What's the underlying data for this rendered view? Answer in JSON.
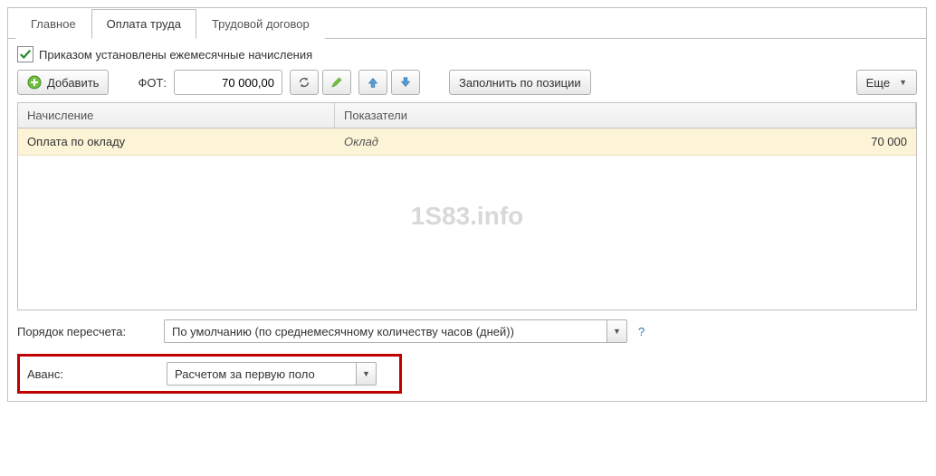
{
  "tabs": {
    "main": "Главное",
    "pay": "Оплата труда",
    "contract": "Трудовой договор"
  },
  "checkbox_label": "Приказом установлены ежемесячные начисления",
  "toolbar": {
    "add": "Добавить",
    "fot_label": "ФОТ:",
    "fot_value": "70 000,00",
    "fill_by_position": "Заполнить по позиции",
    "more": "Еще"
  },
  "table": {
    "headers": {
      "accrual": "Начисление",
      "indicators": "Показатели"
    },
    "rows": [
      {
        "name": "Оплата по окладу",
        "indicator": "Оклад",
        "value": "70 000"
      }
    ]
  },
  "watermark": "1S83.info",
  "recalc": {
    "label": "Порядок пересчета:",
    "value": "По умолчанию (по среднемесячному количеству часов (дней))",
    "help": "?"
  },
  "advance": {
    "label": "Аванс:",
    "value": "Расчетом за первую поло"
  }
}
